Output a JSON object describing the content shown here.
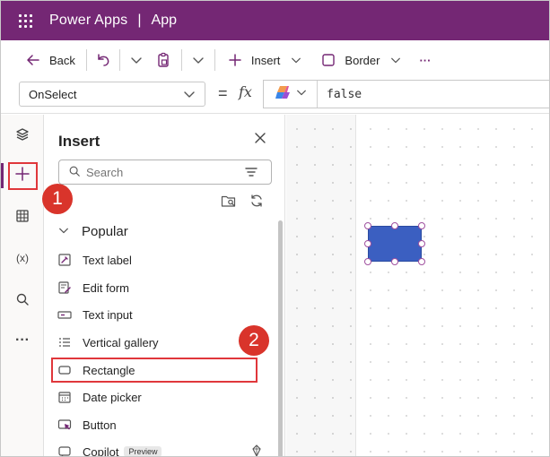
{
  "topbar": {
    "brand": "Power Apps",
    "separator": "|",
    "app_name": "App"
  },
  "toolbar": {
    "back_label": "Back",
    "insert_label": "Insert",
    "border_label": "Border",
    "more_label": "···"
  },
  "formula_bar": {
    "property": "OnSelect",
    "equals": "=",
    "fx": "fx",
    "formula": "false"
  },
  "rail": {
    "items": [
      "tree-view",
      "insert",
      "data",
      "variables",
      "search",
      "more"
    ],
    "variables_label": "(x)",
    "more_label": "···"
  },
  "insert_pane": {
    "title": "Insert",
    "search_placeholder": "Search",
    "group": "Popular",
    "items": [
      {
        "label": "Text label",
        "icon": "text-label-icon"
      },
      {
        "label": "Edit form",
        "icon": "edit-form-icon"
      },
      {
        "label": "Text input",
        "icon": "text-input-icon"
      },
      {
        "label": "Vertical gallery",
        "icon": "vertical-gallery-icon"
      },
      {
        "label": "Rectangle",
        "icon": "rectangle-icon"
      },
      {
        "label": "Date picker",
        "icon": "date-picker-icon"
      },
      {
        "label": "Button",
        "icon": "button-icon"
      },
      {
        "label": "Copilot",
        "icon": "copilot-icon",
        "tag": "Preview"
      }
    ]
  },
  "callouts": {
    "step1": "1",
    "step2": "2"
  },
  "colors": {
    "brand": "#742774",
    "callout": "#d9342b",
    "highlight": "#e0373b",
    "rectangle_fill": "#3b5fc1"
  }
}
